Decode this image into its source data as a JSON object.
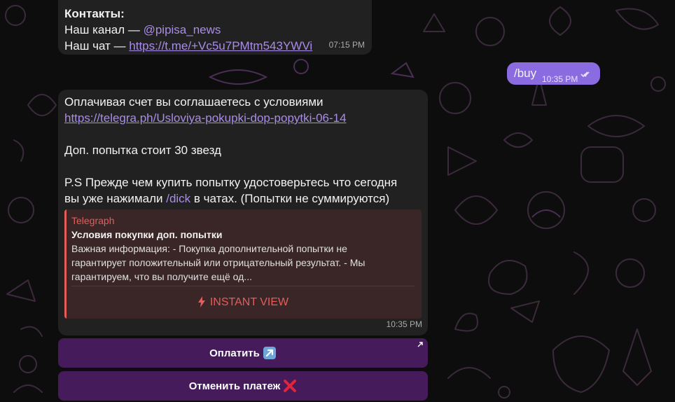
{
  "messages": {
    "contacts": {
      "heading": "Контакты:",
      "channel_prefix": "Наш канал — ",
      "channel_mention": "@pipisa_news",
      "chat_prefix": "Наш чат — ",
      "chat_link": "https://t.me/+Vc5u7PMtm543YWVi",
      "time": "07:15 PM"
    },
    "outgoing": {
      "text": "/buy",
      "time": "10:35 PM",
      "status_icon": "double-check-icon"
    },
    "invoice": {
      "line1": "Оплачивая счет вы соглашаетесь с условиями",
      "terms_link": "https://telegra.ph/Usloviya-pokupki-dop-popytki-06-14",
      "price_line": "Доп. попытка стоит 30 звезд",
      "ps_line1": "P.S Прежде чем купить попытку удостоверьтесь что сегодня",
      "ps_line2_prefix": "вы уже нажимали ",
      "ps_command": "/dick",
      "ps_line2_suffix": " в чатах. (Попытки не суммируются)",
      "time": "10:35 PM",
      "preview": {
        "site": "Telegraph",
        "title": "Условия покупки доп. попытки",
        "desc_line1": "Важная информация: - Покупка дополнительной попытки не",
        "desc_line2": "гарантирует положительный или отрицательный результат. - Мы",
        "desc_line3": "гарантируем, что вы получите ещё од...",
        "instant_view_label": "INSTANT VIEW"
      }
    }
  },
  "keyboard": {
    "pay_label": "Оплатить",
    "pay_icon": "arrow-up-right-emoji",
    "cancel_label": "Отменить платеж",
    "cancel_icon": "cross-mark-emoji"
  },
  "colors": {
    "background": "#0d0d0d",
    "bubble_in": "#212121",
    "bubble_out": "#8b6ce0",
    "link": "#a98ce8",
    "preview_accent": "#e35d5b",
    "keyboard_button": "#521e6c"
  }
}
